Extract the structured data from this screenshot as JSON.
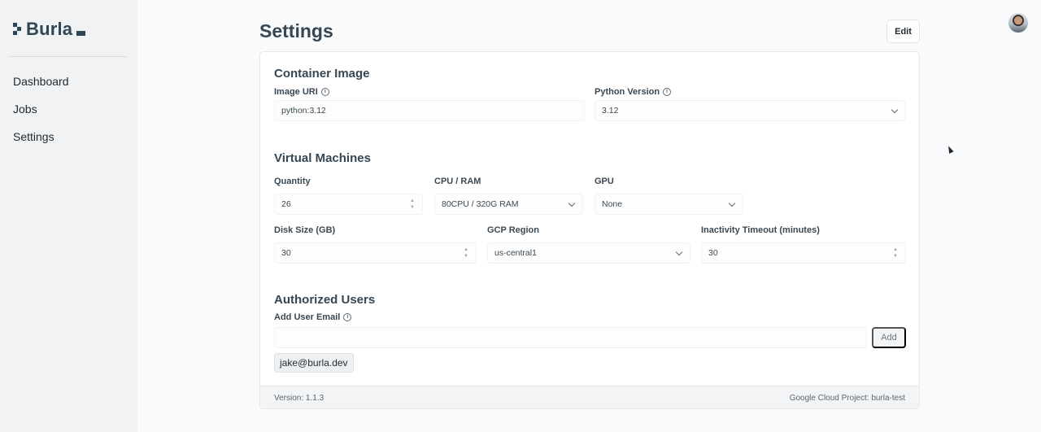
{
  "brand": {
    "name": "Burla"
  },
  "sidebar": {
    "items": [
      {
        "label": "Dashboard"
      },
      {
        "label": "Jobs"
      },
      {
        "label": "Settings"
      }
    ]
  },
  "header": {
    "title": "Settings",
    "edit_label": "Edit"
  },
  "container_image": {
    "title": "Container Image",
    "image_uri_label": "Image URI",
    "image_uri_value": "python:3.12",
    "python_version_label": "Python Version",
    "python_version_value": "3.12"
  },
  "virtual_machines": {
    "title": "Virtual Machines",
    "quantity_label": "Quantity",
    "quantity_value": "26",
    "cpu_ram_label": "CPU / RAM",
    "cpu_ram_value": "80CPU / 320G RAM",
    "gpu_label": "GPU",
    "gpu_value": "None",
    "disk_size_label": "Disk Size (GB)",
    "disk_size_value": "30",
    "gcp_region_label": "GCP Region",
    "gcp_region_value": "us-central1",
    "inactivity_label": "Inactivity Timeout (minutes)",
    "inactivity_value": "30"
  },
  "authorized_users": {
    "title": "Authorized Users",
    "add_email_label": "Add User Email",
    "add_email_value": "",
    "add_label": "Add",
    "users": [
      "jake@burla.dev"
    ]
  },
  "footer": {
    "version": "Version: 1.1.3",
    "project": "Google Cloud Project: burla-test"
  }
}
